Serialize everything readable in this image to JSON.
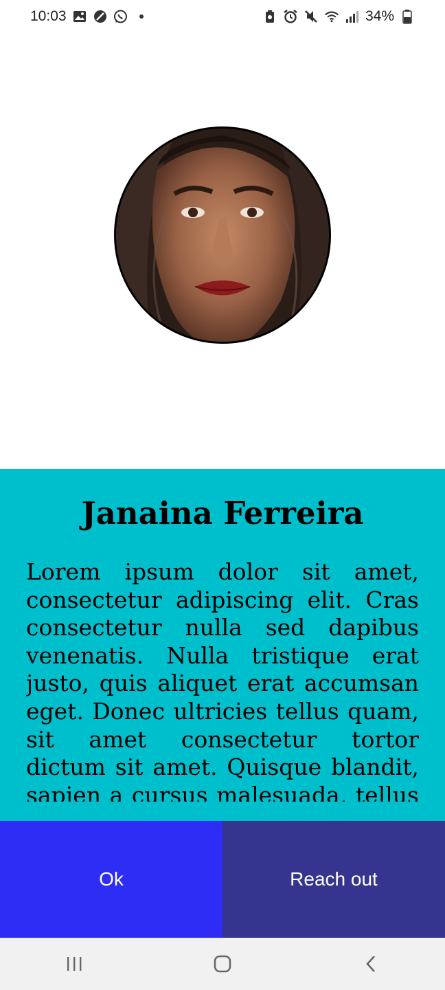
{
  "status_bar": {
    "time": "10:03",
    "battery": "34%",
    "left_icons": [
      "image-icon",
      "no-disturb-icon",
      "whatsapp-icon",
      "dot-icon"
    ],
    "right_icons": [
      "battery-saver-icon",
      "alarm-icon",
      "mute-icon",
      "wifi-icon",
      "signal-icon",
      "battery-icon"
    ]
  },
  "profile": {
    "name": "Janaina Ferreira",
    "bio": "Lorem ipsum dolor sit amet, consectetur adipiscing elit. Cras consectetur nulla sed dapibus venenatis. Nulla tristique erat justo, quis aliquet erat accumsan eget. Donec ultricies tellus quam, sit amet consectetur tortor dictum sit amet. Quisque blandit, sapien a cursus malesuada, tellus sem"
  },
  "buttons": {
    "ok_label": "Ok",
    "reach_label": "Reach out"
  },
  "nav": {
    "items": [
      "recents-icon",
      "home-icon",
      "back-icon"
    ]
  },
  "colors": {
    "panel": "#00bfcc",
    "ok_button": "#2d2df5",
    "reach_button": "#35348f"
  }
}
